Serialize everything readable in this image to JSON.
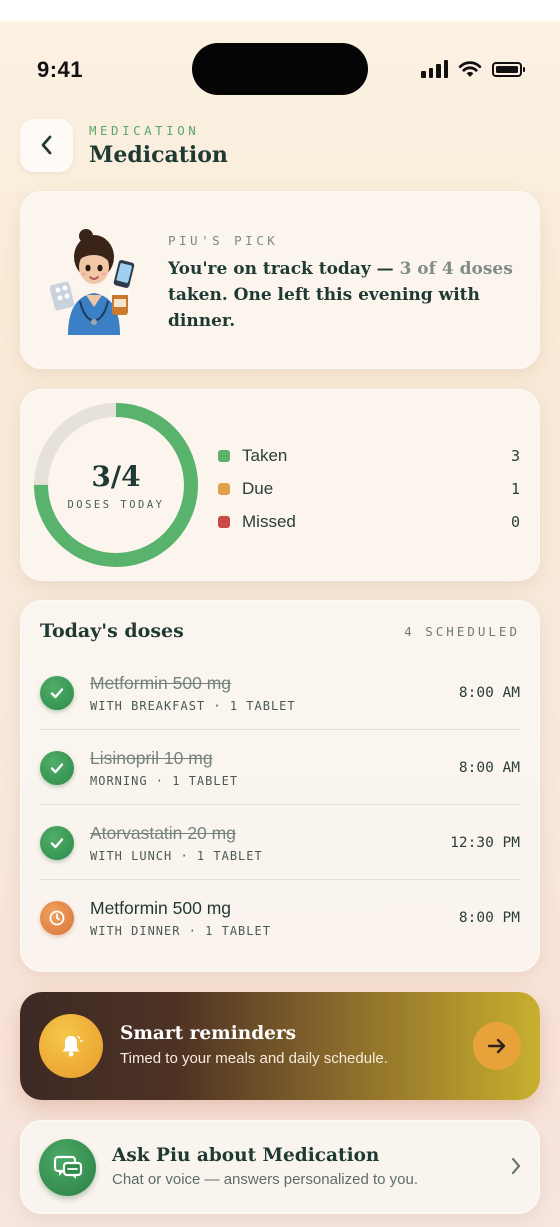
{
  "status_bar": {
    "time": "9:41"
  },
  "header": {
    "eyebrow": "MEDICATION",
    "title": "Medication"
  },
  "pick": {
    "label": "PIU'S PICK",
    "message_main": "You're on track today — ",
    "message_highlight": "3 of 4 doses",
    "message_rest": " taken. One left this evening with dinner."
  },
  "summary": {
    "value": "3/4",
    "caption": "DOSES TODAY",
    "progress_fraction": 0.75,
    "legend": [
      {
        "label": "Taken",
        "count": "3",
        "color": "#5ab36c"
      },
      {
        "label": "Due",
        "count": "1",
        "color": "#e3a04a"
      },
      {
        "label": "Missed",
        "count": "0",
        "color": "#cc4a44"
      }
    ]
  },
  "doses": {
    "title": "Today's doses",
    "count": "4 SCHEDULED",
    "items": [
      {
        "name": "Metformin 500 mg",
        "detail": "WITH BREAKFAST · 1 TABLET",
        "time": "8:00 AM",
        "status": "taken"
      },
      {
        "name": "Lisinopril 10 mg",
        "detail": "MORNING · 1 TABLET",
        "time": "8:00 AM",
        "status": "taken"
      },
      {
        "name": "Atorvastatin 20 mg",
        "detail": "WITH LUNCH · 1 TABLET",
        "time": "12:30 PM",
        "status": "taken"
      },
      {
        "name": "Metformin 500 mg",
        "detail": "WITH DINNER · 1 TABLET",
        "time": "8:00 PM",
        "status": "due"
      }
    ]
  },
  "reminders": {
    "title": "Smart reminders",
    "subtitle": "Timed to your meals and daily schedule."
  },
  "ask": {
    "title": "Ask Piu about Medication",
    "subtitle": "Chat or voice — answers personalized to you."
  },
  "colors": {
    "accent_green": "#5ab36c",
    "ring_track": "#e6e2da"
  }
}
